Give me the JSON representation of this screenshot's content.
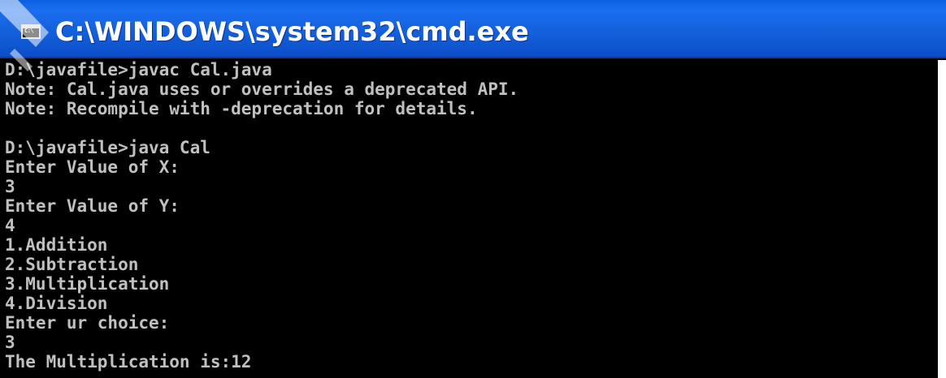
{
  "window": {
    "title": "C:\\WINDOWS\\system32\\cmd.exe",
    "icon": "console-window-icon",
    "icon_glyph": "C:\\",
    "accent_color": "#0b56d8",
    "background_color": "#000000",
    "text_color": "#c0c0c0"
  },
  "console": {
    "lines": [
      "D:\\javafile>javac Cal.java",
      "Note: Cal.java uses or overrides a deprecated API.",
      "Note: Recompile with -deprecation for details.",
      "",
      "D:\\javafile>java Cal",
      "Enter Value of X:",
      "3",
      "Enter Value of Y:",
      "4",
      "1.Addition",
      "2.Subtraction",
      "3.Multiplication",
      "4.Division",
      "Enter ur choice:",
      "3",
      "The Multiplication is:12"
    ]
  }
}
